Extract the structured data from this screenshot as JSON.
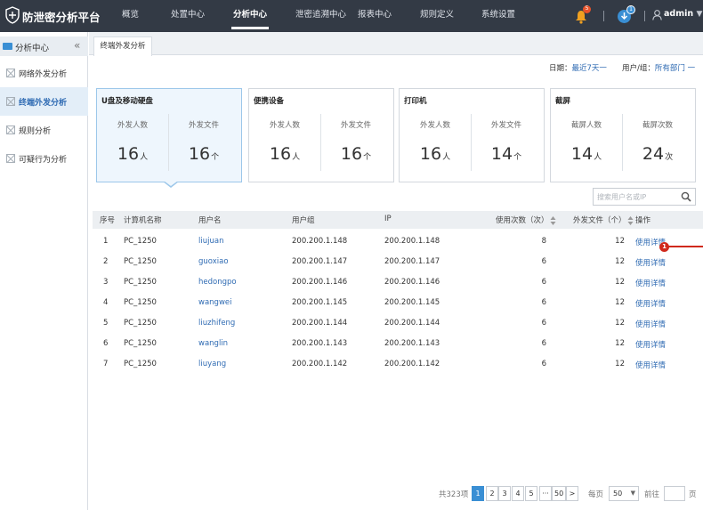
{
  "app": {
    "title": "防泄密分析平台"
  },
  "nav": [
    "概览",
    "处置中心",
    "分析中心",
    "泄密追溯中心",
    "报表中心",
    "规则定义",
    "系统设置"
  ],
  "header": {
    "notif_count": "5",
    "download_count": "1",
    "user": "admin"
  },
  "sidebar": {
    "title": "分析中心",
    "items": [
      "网络外发分析",
      "终端外发分析",
      "规则分析",
      "可疑行为分析"
    ]
  },
  "tab": "终端外发分析",
  "filter": {
    "date_label": "日期：",
    "date_value": "最近7天一",
    "group_label": "用户/组：",
    "group_value": "所有部门 一"
  },
  "cards": [
    {
      "title": "U盘及移动硬盘",
      "stats": [
        {
          "label": "外发人数",
          "value": "16",
          "unit": "人"
        },
        {
          "label": "外发文件",
          "value": "16",
          "unit": "个"
        }
      ]
    },
    {
      "title": "便携设备",
      "stats": [
        {
          "label": "外发人数",
          "value": "16",
          "unit": "人"
        },
        {
          "label": "外发文件",
          "value": "16",
          "unit": "个"
        }
      ]
    },
    {
      "title": "打印机",
      "stats": [
        {
          "label": "外发人数",
          "value": "16",
          "unit": "人"
        },
        {
          "label": "外发文件",
          "value": "14",
          "unit": "个"
        }
      ]
    },
    {
      "title": "截屏",
      "stats": [
        {
          "label": "截屏人数",
          "value": "14",
          "unit": "人"
        },
        {
          "label": "截屏次数",
          "value": "24",
          "unit": "次"
        }
      ]
    }
  ],
  "search": {
    "placeholder": "搜索用户名或IP"
  },
  "table": {
    "headers": [
      "序号",
      "计算机名称",
      "用户名",
      "用户组",
      "IP",
      "使用次数（次）",
      "外发文件（个）",
      "操作"
    ],
    "rows": [
      [
        "1",
        "PC_1250",
        "liujuan",
        "200.200.1.148",
        "200.200.1.148",
        "8",
        "12",
        "使用详情"
      ],
      [
        "2",
        "PC_1250",
        "guoxiao",
        "200.200.1.147",
        "200.200.1.147",
        "6",
        "12",
        "使用详情"
      ],
      [
        "3",
        "PC_1250",
        "hedongpo",
        "200.200.1.146",
        "200.200.1.146",
        "6",
        "12",
        "使用详情"
      ],
      [
        "4",
        "PC_1250",
        "wangwei",
        "200.200.1.145",
        "200.200.1.145",
        "6",
        "12",
        "使用详情"
      ],
      [
        "5",
        "PC_1250",
        "liuzhifeng",
        "200.200.1.144",
        "200.200.1.144",
        "6",
        "12",
        "使用详情"
      ],
      [
        "6",
        "PC_1250",
        "wanglin",
        "200.200.1.143",
        "200.200.1.143",
        "6",
        "12",
        "使用详情"
      ],
      [
        "7",
        "PC_1250",
        "liuyang",
        "200.200.1.142",
        "200.200.1.142",
        "6",
        "12",
        "使用详情"
      ]
    ]
  },
  "marker": "1",
  "pagination": {
    "total": "共323项",
    "pages": [
      "1",
      "2",
      "3",
      "4",
      "5",
      "···",
      "50",
      ">"
    ],
    "per_page_label": "每页",
    "per_page": "50",
    "goto_label": "前往",
    "page_suffix": "页"
  },
  "colors": {
    "topbar": "#333a45",
    "accent": "#3a8fd4",
    "link": "#2f6bb3",
    "marker": "#d0291c",
    "notify": "#e8532a"
  }
}
